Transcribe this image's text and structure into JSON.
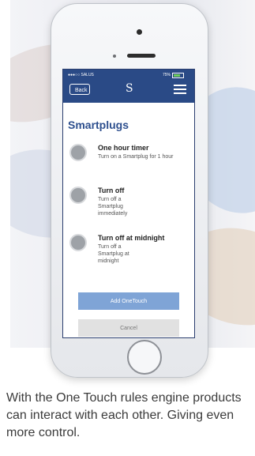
{
  "status_bar": {
    "carrier": "●●●○○ SALUS",
    "battery_percent": "75%"
  },
  "header": {
    "back_label": "Back",
    "logo_glyph": "S"
  },
  "page_title": "Smartplugs",
  "options": [
    {
      "title": "One hour timer",
      "description": "Turn on a Smartplug for 1 hour"
    },
    {
      "title": "Turn off",
      "description": "Turn off a Smartplug immediately"
    },
    {
      "title": "Turn off at midnight",
      "description": "Turn off a Smartplug at midnight"
    }
  ],
  "actions": {
    "primary_label": "Add OneTouch",
    "secondary_label": "Cancel"
  },
  "caption": "With the One Touch rules engine products can interact with each other. Giving even more control.",
  "colors": {
    "header_bg": "#2a4a86",
    "title": "#2d4f8e",
    "primary_button": "#7fa4d6",
    "radio": "#9ea2a7"
  },
  "icons": {
    "menu": "hamburger-icon",
    "logo": "salus-logo-icon"
  }
}
